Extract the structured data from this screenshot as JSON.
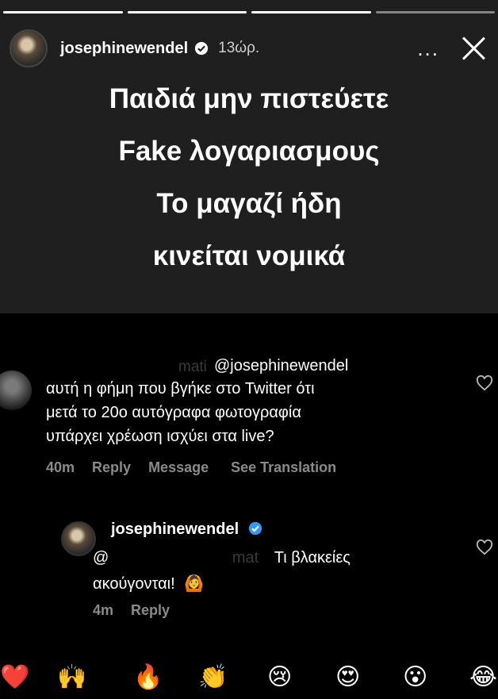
{
  "story": {
    "username": "josephinewendel",
    "time": "13ώρ.",
    "more_label": "...",
    "lines": [
      "Παιδιά μην πιστεύετε",
      "Fake λογαριασμους",
      "Το μαγαζί ήδη",
      "κινείται νομικά"
    ]
  },
  "comment": {
    "author_faded": "mati",
    "mention": "@josephinewendel",
    "lines": [
      "αυτή η φήμη που βγήκε στο Twitter ότι",
      "μετά το 20ο αυτόγραφα φωτογραφία",
      "υπάρχει χρέωση ισχύει στα live?"
    ],
    "time": "40m",
    "reply": "Reply",
    "message": "Message",
    "see_translation": "See Translation"
  },
  "reply": {
    "username": "josephinewendel",
    "at": "@",
    "faded_handle": "mat",
    "text_line1": "Τι βλακείες",
    "text_line2": "ακούγονται!",
    "emoji": "🙆",
    "time": "4m",
    "reply": "Reply"
  },
  "reactions": [
    "❤️",
    "🙌",
    "🔥",
    "👏",
    "😢",
    "😍",
    "😮",
    "😂"
  ]
}
